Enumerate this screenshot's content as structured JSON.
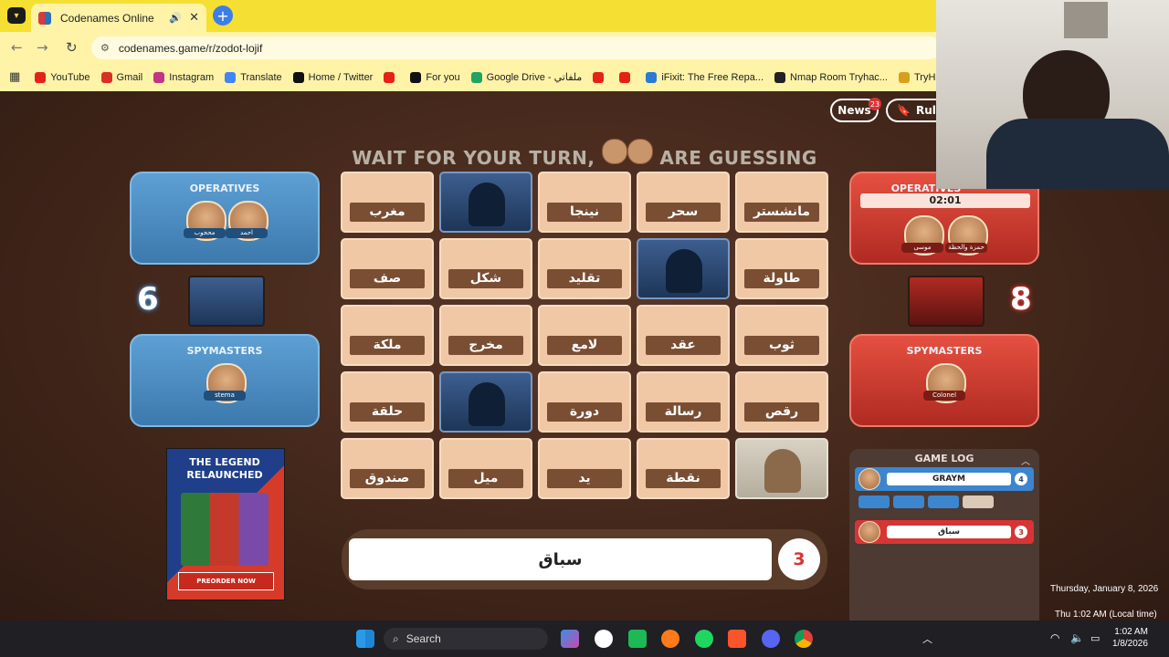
{
  "browser": {
    "tab_title": "Codenames Online",
    "url": "codenames.game/r/zodot-lojif",
    "bookmarks": [
      {
        "label": "YouTube",
        "color": "#e62117"
      },
      {
        "label": "Gmail",
        "color": "#d93025"
      },
      {
        "label": "Instagram",
        "color": "#c13584"
      },
      {
        "label": "Translate",
        "color": "#4285f4"
      },
      {
        "label": "Home / Twitter",
        "color": "#111111"
      },
      {
        "label": "",
        "color": "#e62117"
      },
      {
        "label": "For you",
        "color": "#111111"
      },
      {
        "label": "Google Drive - ملفاتي",
        "color": "#1fa463"
      },
      {
        "label": "",
        "color": "#e62117"
      },
      {
        "label": "",
        "color": "#e62117"
      },
      {
        "label": "iFixit: The Free Repa...",
        "color": "#2a7bd6"
      },
      {
        "label": "Nmap Room Tryhac...",
        "color": "#222222"
      },
      {
        "label": "TryHackMe |",
        "color": "#d8a019"
      }
    ]
  },
  "header": {
    "news_label": "News",
    "news_badge": "23",
    "rules_label": "Rule",
    "wait_prefix": "WAIT FOR YOUR TURN,",
    "wait_suffix": "ARE GUESSING"
  },
  "blue_team": {
    "operatives_label": "OPERATIVES",
    "operatives": [
      {
        "name": "محجوب"
      },
      {
        "name": "احمد"
      }
    ],
    "score": "6",
    "spymasters_label": "SPYMASTERS",
    "spymaster": "stema"
  },
  "red_team": {
    "operatives_label": "OPERATIVES",
    "timer": "02:01",
    "operatives": [
      {
        "name": "موسى"
      },
      {
        "name": "حمزة والحظة"
      }
    ],
    "score": "8",
    "spymasters_label": "SPYMASTERS",
    "spymaster": "Colonel"
  },
  "board": [
    {
      "word": "مغرب",
      "state": "hidden"
    },
    {
      "word": "",
      "state": "blue"
    },
    {
      "word": "نينجا",
      "state": "hidden"
    },
    {
      "word": "سحر",
      "state": "hidden"
    },
    {
      "word": "مانشستر",
      "state": "hidden"
    },
    {
      "word": "صف",
      "state": "hidden"
    },
    {
      "word": "شكل",
      "state": "hidden"
    },
    {
      "word": "تقليد",
      "state": "hidden"
    },
    {
      "word": "",
      "state": "blue"
    },
    {
      "word": "طاولة",
      "state": "hidden"
    },
    {
      "word": "ملكة",
      "state": "hidden"
    },
    {
      "word": "مخرج",
      "state": "hidden"
    },
    {
      "word": "لامع",
      "state": "hidden"
    },
    {
      "word": "عقد",
      "state": "hidden"
    },
    {
      "word": "ثوب",
      "state": "hidden"
    },
    {
      "word": "حلقة",
      "state": "hidden"
    },
    {
      "word": "",
      "state": "blue"
    },
    {
      "word": "دورة",
      "state": "hidden"
    },
    {
      "word": "رسالة",
      "state": "hidden"
    },
    {
      "word": "رقص",
      "state": "hidden"
    },
    {
      "word": "صندوق",
      "state": "hidden"
    },
    {
      "word": "ميل",
      "state": "hidden"
    },
    {
      "word": "يد",
      "state": "hidden"
    },
    {
      "word": "نقطة",
      "state": "hidden"
    },
    {
      "word": "",
      "state": "neutral"
    }
  ],
  "clue": {
    "word": "سباق",
    "count": "3"
  },
  "ad": {
    "title": "THE LEGEND RELAUNCHED",
    "button": "PREORDER NOW"
  },
  "game_log": {
    "title": "GAME LOG",
    "entries": [
      {
        "player": "stema",
        "clue": "GRAYM",
        "count": "4",
        "team": "blue"
      },
      {
        "player": "Colonel",
        "clue": "سباق",
        "count": "3",
        "team": "red"
      }
    ]
  },
  "taskbar": {
    "search_placeholder": "Search",
    "time": "1:02 AM",
    "date": "1/8/2026",
    "popup_date": "Thursday, January 8, 2026",
    "popup_local": "Thu 1:02 AM (Local time)"
  }
}
